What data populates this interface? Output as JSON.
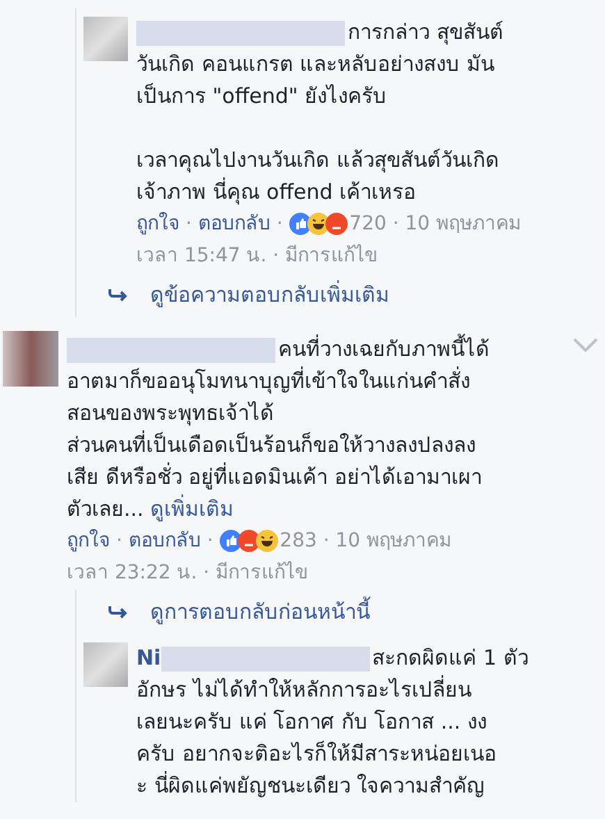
{
  "separator": "·",
  "items": [
    {
      "kind": "reply",
      "first_line": "การกล่าว สุขสันต์",
      "text": "วันเกิด คอนแกรต และหลับอย่างสงบ มัน\nเป็นการ \"offend\" ยังไงครับ\n\nเวลาคุณไปงานวันเกิด แล้วสุขสันต์วันเกิด\nเจ้าภาพ นี่คุณ offend เค้าเหรอ",
      "like_label": "ถูกใจ",
      "reply_label": "ตอบกลับ",
      "reactions": [
        {
          "kind": "like"
        },
        {
          "kind": "haha"
        },
        {
          "kind": "angry"
        }
      ],
      "count": "720",
      "date": "10 พฤษภาคม",
      "time": "เวลา 15:47 น.",
      "edited": "มีการแก้ไข"
    },
    {
      "kind": "more_link",
      "text": "ดูข้อความตอบกลับเพิ่มเติม"
    },
    {
      "kind": "comment",
      "first_line": "คนที่วางเฉยกับภาพนี้ได้",
      "text": "อาตมาก็ขออนุโมทนาบุญที่เข้าใจในแก่นคำสั่ง\nสอนของพระพุทธเจ้าได้\nส่วนคนที่เป็นเดือดเป็นร้อนก็ขอให้วางลงปลงลง\nเสีย ดีหรือชั่ว อยู่ที่แอดมินเค้า อย่าได้เอามาเผา\nตัวเลย...",
      "see_more": "ดูเพิ่มเติม",
      "like_label": "ถูกใจ",
      "reply_label": "ตอบกลับ",
      "reactions": [
        {
          "kind": "like"
        },
        {
          "kind": "angry"
        },
        {
          "kind": "haha"
        }
      ],
      "count": "283",
      "date": "10 พฤษภาคม",
      "time": "เวลา 23:22 น.",
      "edited": "มีการแก้ไข"
    },
    {
      "kind": "more_link",
      "text": "ดูการตอบกลับก่อนหน้านี้"
    },
    {
      "kind": "reply",
      "name": "Ni",
      "first_line": "สะกดผิดแค่ 1 ตัว",
      "text": "อักษร ไม่ได้ทำให้หลักการอะไรเปลี่ยน\nเลยนะครับ แค่ โอกาศ กับ โอกาส ... งง\nครับ อยากจะติอะไรก็ให้มีสาระหน่อยเนอ\nะ นี่ผิดแค่พยัญชนะเดียว ใจความสำคัญ"
    }
  ]
}
